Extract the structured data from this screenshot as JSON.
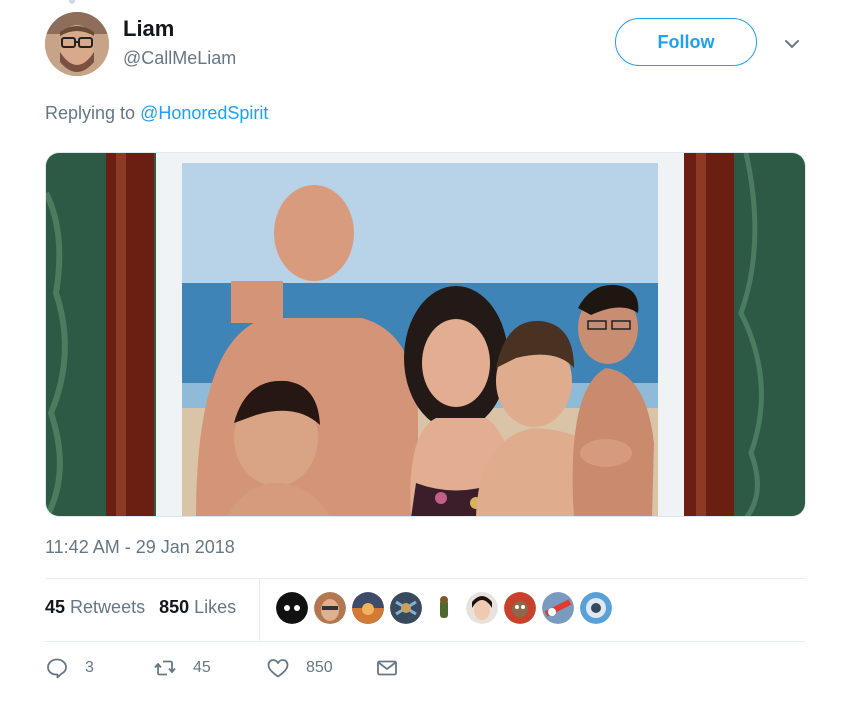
{
  "author": {
    "display_name": "Liam",
    "handle": "@CallMeLiam",
    "avatar_icon": "avatar-photo"
  },
  "follow_label": "Follow",
  "reply_context": {
    "prefix": "Replying to",
    "mention": "@HonoredSpirit"
  },
  "media": {
    "type": "photo",
    "subject": "framed family beach portrait"
  },
  "timestamp": "11:42 AM - 29 Jan 2018",
  "stats": {
    "retweets_count": "45",
    "retweets_label": "Retweets",
    "likes_count": "850",
    "likes_label": "Likes",
    "liker_count_shown": 9
  },
  "actions": {
    "reply_count": "3",
    "retweet_count": "45",
    "like_count": "850"
  },
  "colors": {
    "accent": "#1da1f2",
    "text_primary": "#14171a",
    "text_secondary": "#657786",
    "divider": "#e6ecf0"
  },
  "icons": {
    "reply": "reply-bubble-icon",
    "retweet": "retweet-icon",
    "like": "heart-icon",
    "dm": "envelope-icon",
    "more": "chevron-down-icon"
  }
}
